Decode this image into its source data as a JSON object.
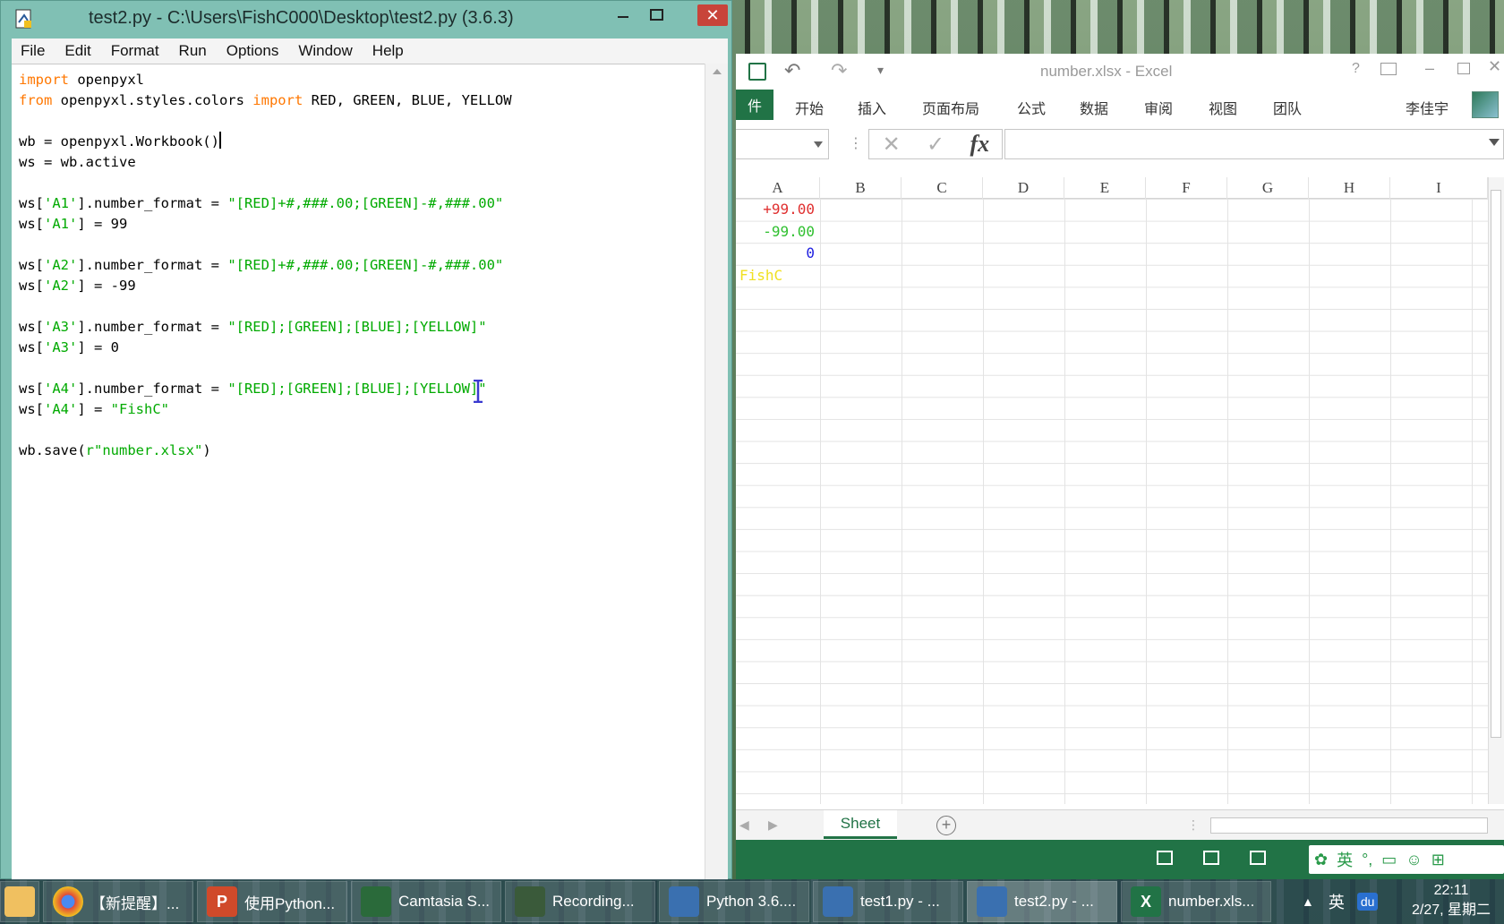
{
  "idle": {
    "title": "test2.py - C:\\Users\\FishC000\\Desktop\\test2.py (3.6.3)",
    "menu": [
      "File",
      "Edit",
      "Format",
      "Run",
      "Options",
      "Window",
      "Help"
    ],
    "code_lines": [
      [
        {
          "t": "import",
          "c": "kw"
        },
        {
          "t": " openpyxl",
          "c": ""
        }
      ],
      [
        {
          "t": "from",
          "c": "kw"
        },
        {
          "t": " openpyxl.styles.colors ",
          "c": ""
        },
        {
          "t": "import",
          "c": "kw"
        },
        {
          "t": " RED, GREEN, BLUE, YELLOW",
          "c": ""
        }
      ],
      [],
      [
        {
          "t": "wb = openpyxl.Workbook()",
          "c": ""
        },
        {
          "t": "|",
          "c": "caret"
        }
      ],
      [
        {
          "t": "ws = wb.active",
          "c": ""
        }
      ],
      [],
      [
        {
          "t": "ws[",
          "c": ""
        },
        {
          "t": "'A1'",
          "c": "str"
        },
        {
          "t": "].number_format = ",
          "c": ""
        },
        {
          "t": "\"[RED]+#,###.00;[GREEN]-#,###.00\"",
          "c": "str"
        }
      ],
      [
        {
          "t": "ws[",
          "c": ""
        },
        {
          "t": "'A1'",
          "c": "str"
        },
        {
          "t": "] = 99",
          "c": ""
        }
      ],
      [],
      [
        {
          "t": "ws[",
          "c": ""
        },
        {
          "t": "'A2'",
          "c": "str"
        },
        {
          "t": "].number_format = ",
          "c": ""
        },
        {
          "t": "\"[RED]+#,###.00;[GREEN]-#,###.00\"",
          "c": "str"
        }
      ],
      [
        {
          "t": "ws[",
          "c": ""
        },
        {
          "t": "'A2'",
          "c": "str"
        },
        {
          "t": "] = -99",
          "c": ""
        }
      ],
      [],
      [
        {
          "t": "ws[",
          "c": ""
        },
        {
          "t": "'A3'",
          "c": "str"
        },
        {
          "t": "].number_format = ",
          "c": ""
        },
        {
          "t": "\"[RED];[GREEN];[BLUE];[YELLOW]\"",
          "c": "str"
        }
      ],
      [
        {
          "t": "ws[",
          "c": ""
        },
        {
          "t": "'A3'",
          "c": "str"
        },
        {
          "t": "] = 0",
          "c": ""
        }
      ],
      [],
      [
        {
          "t": "ws[",
          "c": ""
        },
        {
          "t": "'A4'",
          "c": "str"
        },
        {
          "t": "].number_format = ",
          "c": ""
        },
        {
          "t": "\"[RED];[GREEN];[BLUE];[YELLOW]\"",
          "c": "str"
        }
      ],
      [
        {
          "t": "ws[",
          "c": ""
        },
        {
          "t": "'A4'",
          "c": "str"
        },
        {
          "t": "] = ",
          "c": ""
        },
        {
          "t": "\"FishC\"",
          "c": "str"
        }
      ],
      [],
      [
        {
          "t": "wb.save(",
          "c": ""
        },
        {
          "t": "r\"number.xlsx\"",
          "c": "str"
        },
        {
          "t": ")",
          "c": ""
        }
      ]
    ]
  },
  "excel": {
    "title": "number.xlsx - Excel",
    "file_tab": "件",
    "tabs": [
      "开始",
      "插入",
      "页面布局",
      "公式",
      "数据",
      "审阅",
      "视图",
      "团队"
    ],
    "user": "李佳宇",
    "columns": [
      "A",
      "B",
      "C",
      "D",
      "E",
      "F",
      "G",
      "H",
      "I"
    ],
    "cells": [
      {
        "ref": "A1",
        "text": "+99.00",
        "color": "#e03030",
        "align": "right"
      },
      {
        "ref": "A2",
        "text": "-99.00",
        "color": "#30c030",
        "align": "right"
      },
      {
        "ref": "A3",
        "text": "0",
        "color": "#2020e0",
        "align": "right"
      },
      {
        "ref": "A4",
        "text": "FishC",
        "color": "#f0e020",
        "align": "left"
      }
    ],
    "sheet_tab": "Sheet",
    "accent": "#217346"
  },
  "taskbar": {
    "items": [
      {
        "label": "【新提醒】...",
        "icon": "chrome-icon"
      },
      {
        "label": "使用Python...",
        "icon": "powerpoint-icon",
        "glyph": "P"
      },
      {
        "label": "Camtasia S...",
        "icon": "camtasia-icon"
      },
      {
        "label": "Recording...",
        "icon": "recording-icon"
      },
      {
        "label": "Python 3.6....",
        "icon": "python-icon"
      },
      {
        "label": "test1.py - ...",
        "icon": "python-idle-icon"
      },
      {
        "label": "test2.py - ...",
        "icon": "python-idle-icon"
      },
      {
        "label": "number.xls...",
        "icon": "excel-icon",
        "glyph": "X"
      }
    ],
    "ime": "英",
    "baidu": "du",
    "time": "22:11",
    "date": "2/27, 星期二"
  }
}
